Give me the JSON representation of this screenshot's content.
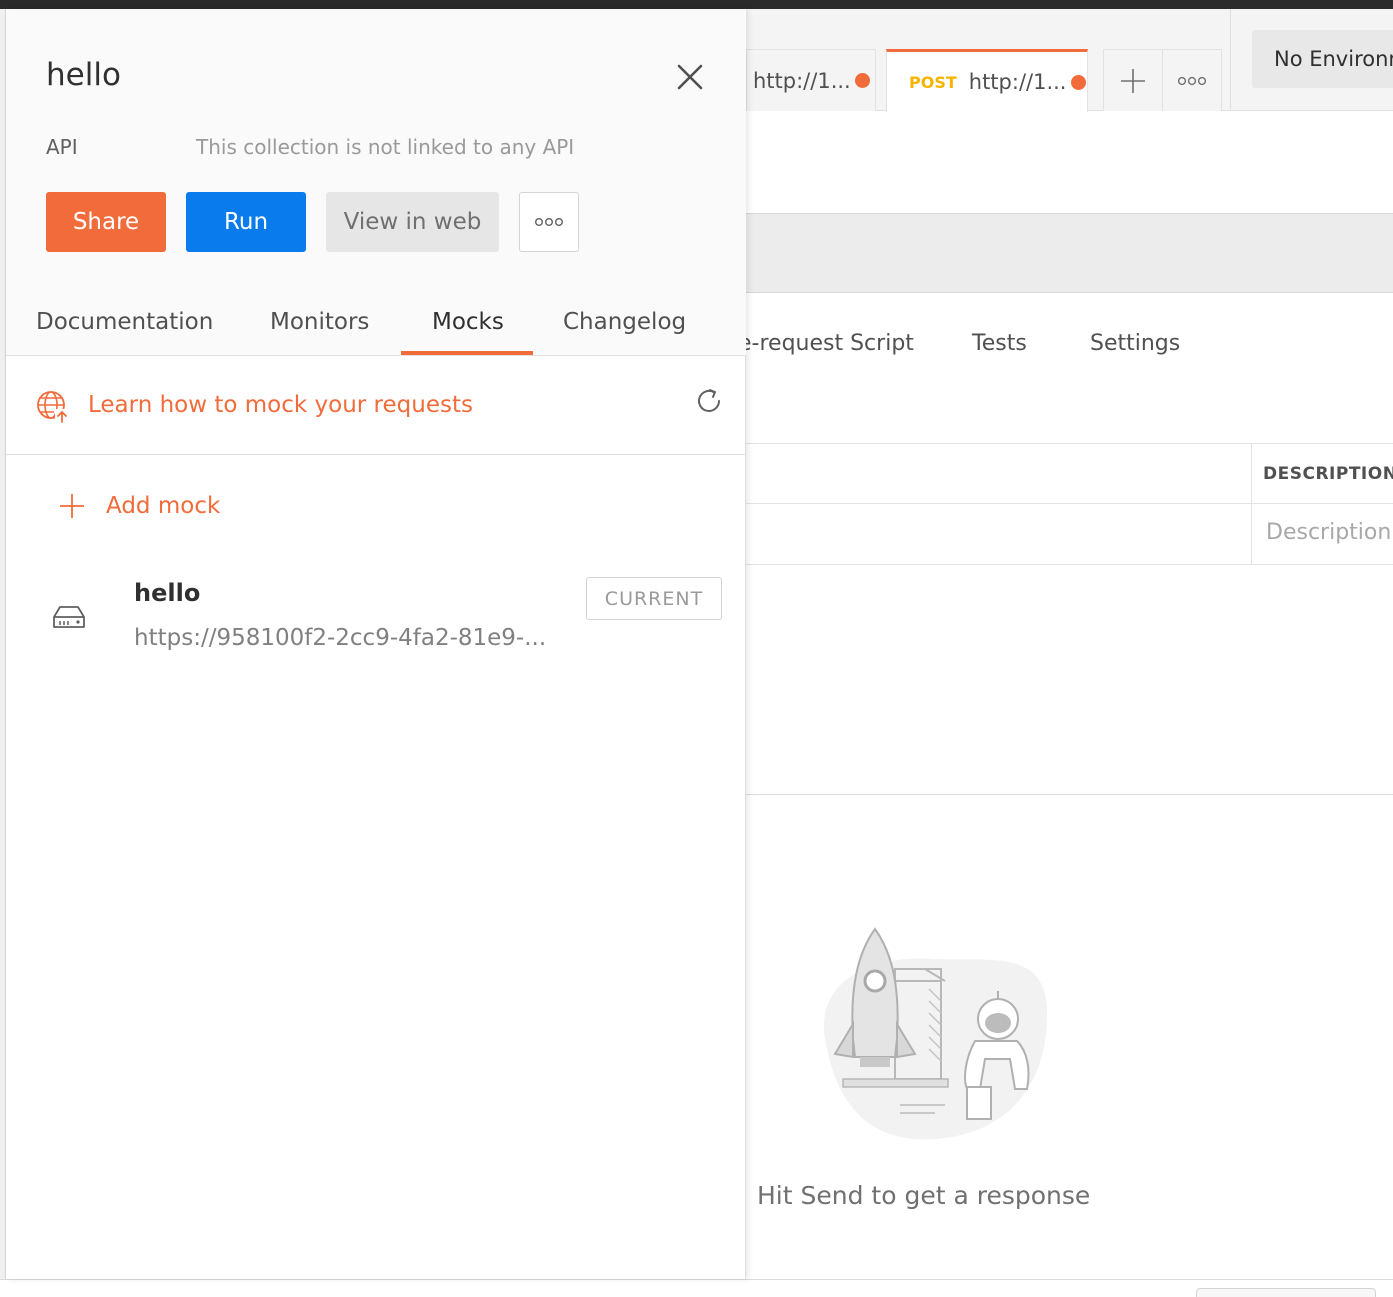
{
  "tabs": {
    "tab1_url": "http://1...",
    "tab2_method": "POST",
    "tab2_url": "http://1...",
    "more_label": "ooo"
  },
  "environment": {
    "selected": "No Environment"
  },
  "request": {
    "subtabs": {
      "prerequest": "e-request Script",
      "tests": "Tests",
      "settings": "Settings"
    },
    "params": {
      "desc_header": "DESCRIPTION",
      "desc_placeholder": "Description"
    }
  },
  "response": {
    "empty_message": "Hit Send to get a response"
  },
  "panel": {
    "title": "hello",
    "api_label": "API",
    "api_status": "This collection is not linked to any API",
    "buttons": {
      "share": "Share",
      "run": "Run",
      "view_web": "View in web",
      "more": "ooo"
    },
    "tabs": [
      "Documentation",
      "Monitors",
      "Mocks",
      "Changelog"
    ],
    "active_tab": "Mocks",
    "learn_link": "Learn how to mock your requests",
    "add_mock": "Add mock",
    "mocks": [
      {
        "name": "hello",
        "url": "https://958100f2-2cc9-4fa2-81e9-...",
        "badge": "CURRENT"
      }
    ]
  },
  "colors": {
    "accent": "#f26b3a",
    "primary": "#097bed",
    "method_post": "#f4b400"
  }
}
